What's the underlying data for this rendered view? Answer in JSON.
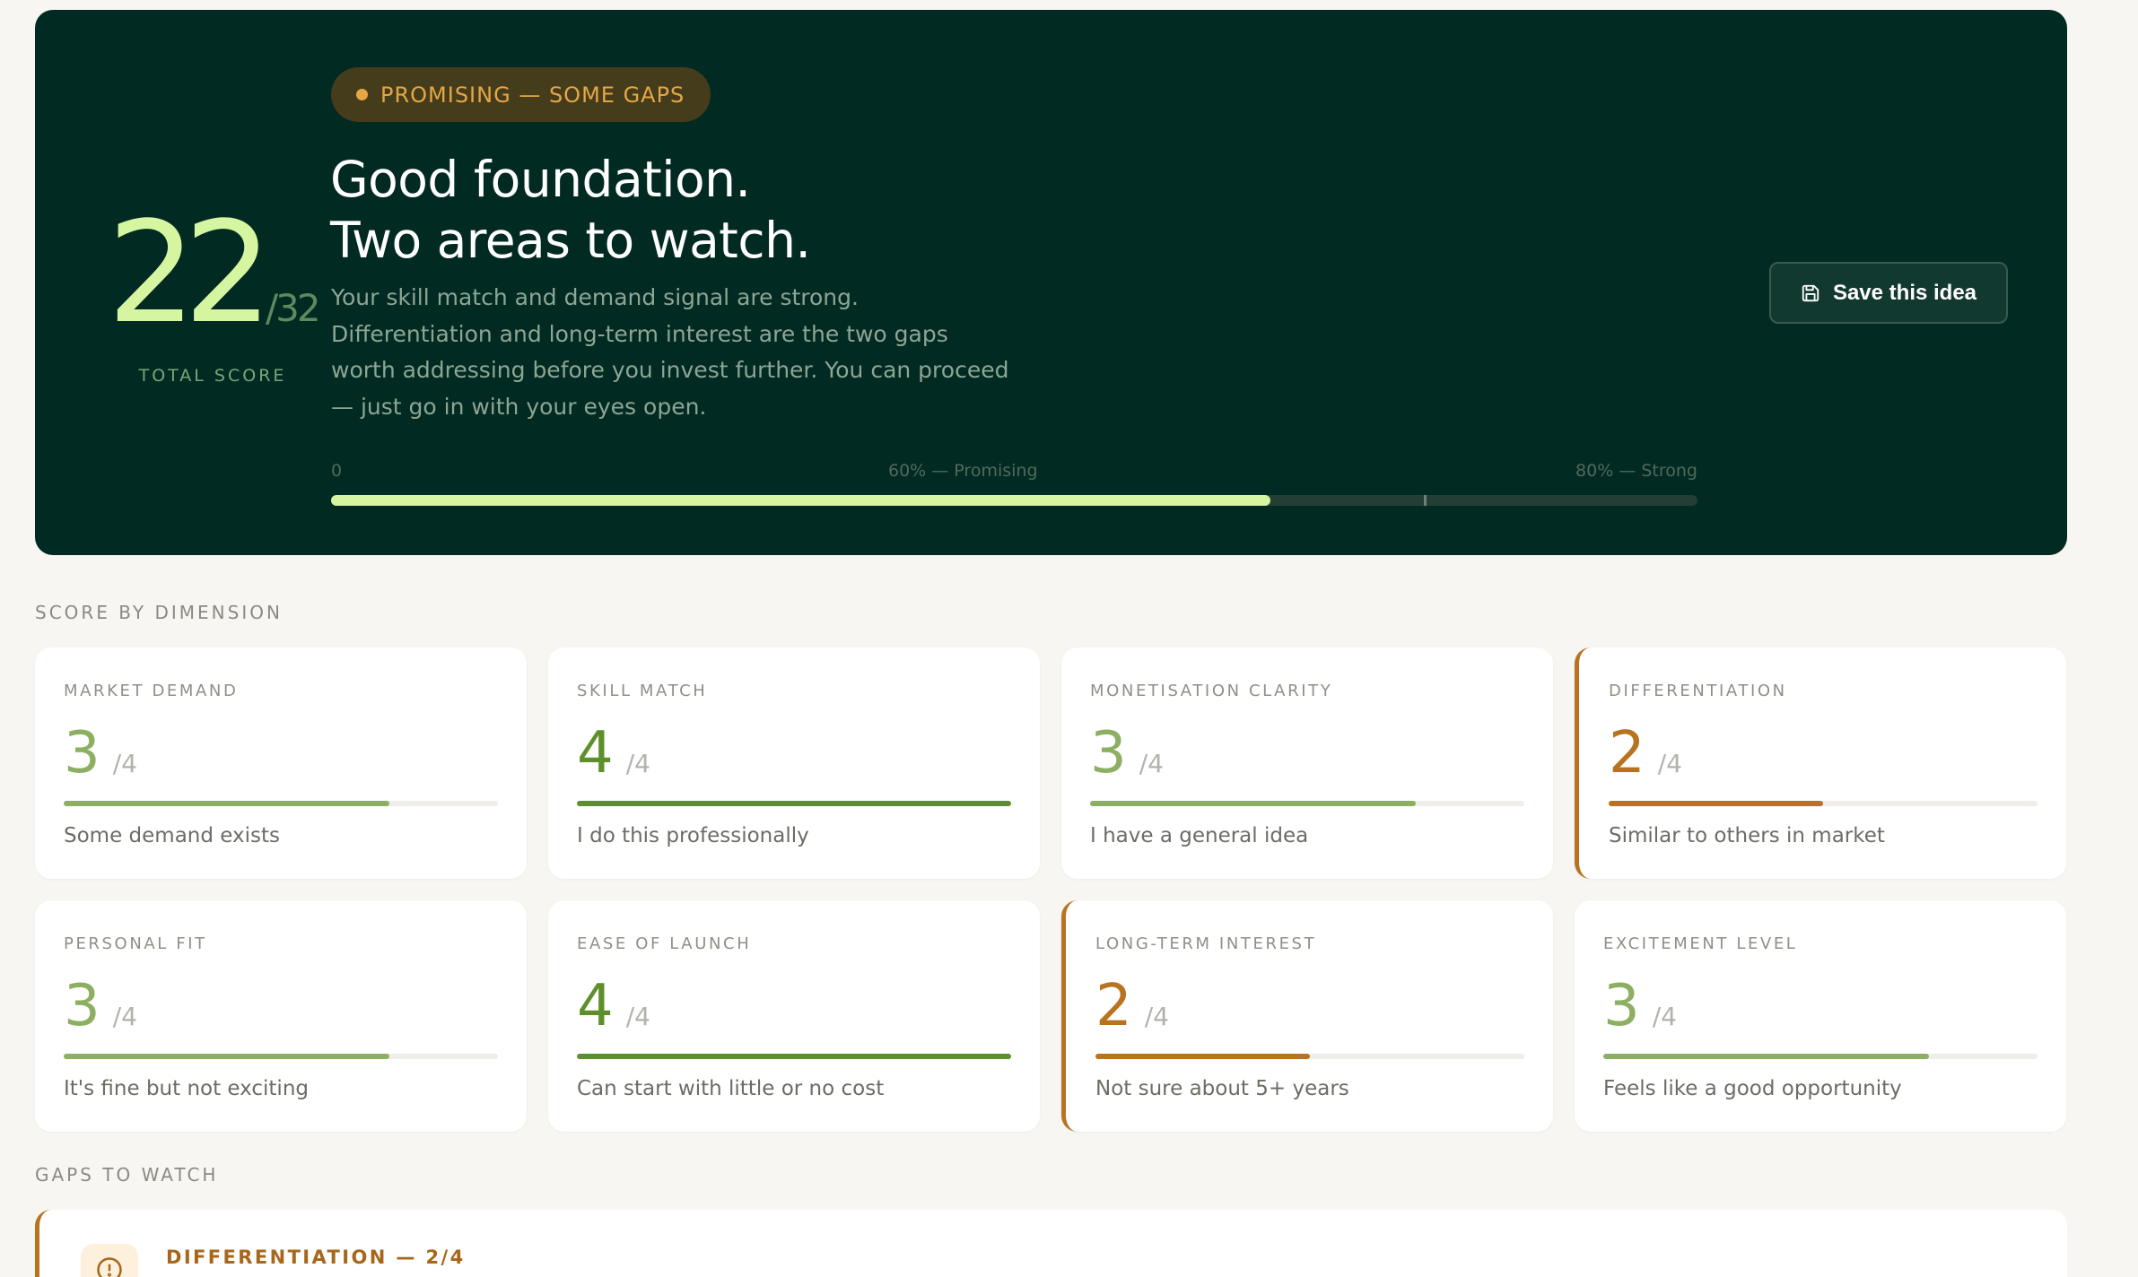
{
  "hero": {
    "badge": "PROMISING — SOME GAPS",
    "headline_line1": "Good foundation.",
    "headline_line2": "Two areas to watch.",
    "description": "Your skill match and demand signal are strong. Differentiation and long-term interest are the two gaps worth addressing before you invest further. You can proceed — just go in with your eyes open.",
    "score": "22",
    "score_max": "/32",
    "score_label": "TOTAL SCORE",
    "progress_value": 0.6875,
    "progress_labels": {
      "start": "0",
      "mid": "60% — Promising",
      "end": "80% — Strong"
    },
    "save_label": "Save this idea",
    "colors": {
      "background": "#012a22",
      "accent": "#d6f5a0",
      "badge": "#e5a646"
    }
  },
  "dimensions": {
    "title": "SCORE BY DIMENSION",
    "max_label": "/4",
    "items": [
      {
        "label": "MARKET DEMAND",
        "score": "3",
        "fraction": 0.75,
        "desc": "Some demand exists",
        "warn": false,
        "color": "#8caf62"
      },
      {
        "label": "SKILL MATCH",
        "score": "4",
        "fraction": 1.0,
        "desc": "I do this professionally",
        "warn": false,
        "color": "#5d8f2b"
      },
      {
        "label": "MONETISATION CLARITY",
        "score": "3",
        "fraction": 0.75,
        "desc": "I have a general idea",
        "warn": false,
        "color": "#8caf62"
      },
      {
        "label": "DIFFERENTIATION",
        "score": "2",
        "fraction": 0.5,
        "desc": "Similar to others in market",
        "warn": true,
        "color": "#b8731f"
      },
      {
        "label": "PERSONAL FIT",
        "score": "3",
        "fraction": 0.75,
        "desc": "It's fine but not exciting",
        "warn": false,
        "color": "#8caf62"
      },
      {
        "label": "EASE OF LAUNCH",
        "score": "4",
        "fraction": 1.0,
        "desc": "Can start with little or no cost",
        "warn": false,
        "color": "#5d8f2b"
      },
      {
        "label": "LONG-TERM INTEREST",
        "score": "2",
        "fraction": 0.5,
        "desc": "Not sure about 5+ years",
        "warn": true,
        "color": "#b8731f"
      },
      {
        "label": "EXCITEMENT LEVEL",
        "score": "3",
        "fraction": 0.75,
        "desc": "Feels like a good opportunity",
        "warn": false,
        "color": "#8caf62"
      }
    ]
  },
  "gaps": {
    "title": "GAPS TO WATCH",
    "items": [
      {
        "title": "DIFFERENTIATION — 2/4",
        "icon": "alert-circle-icon"
      }
    ]
  }
}
